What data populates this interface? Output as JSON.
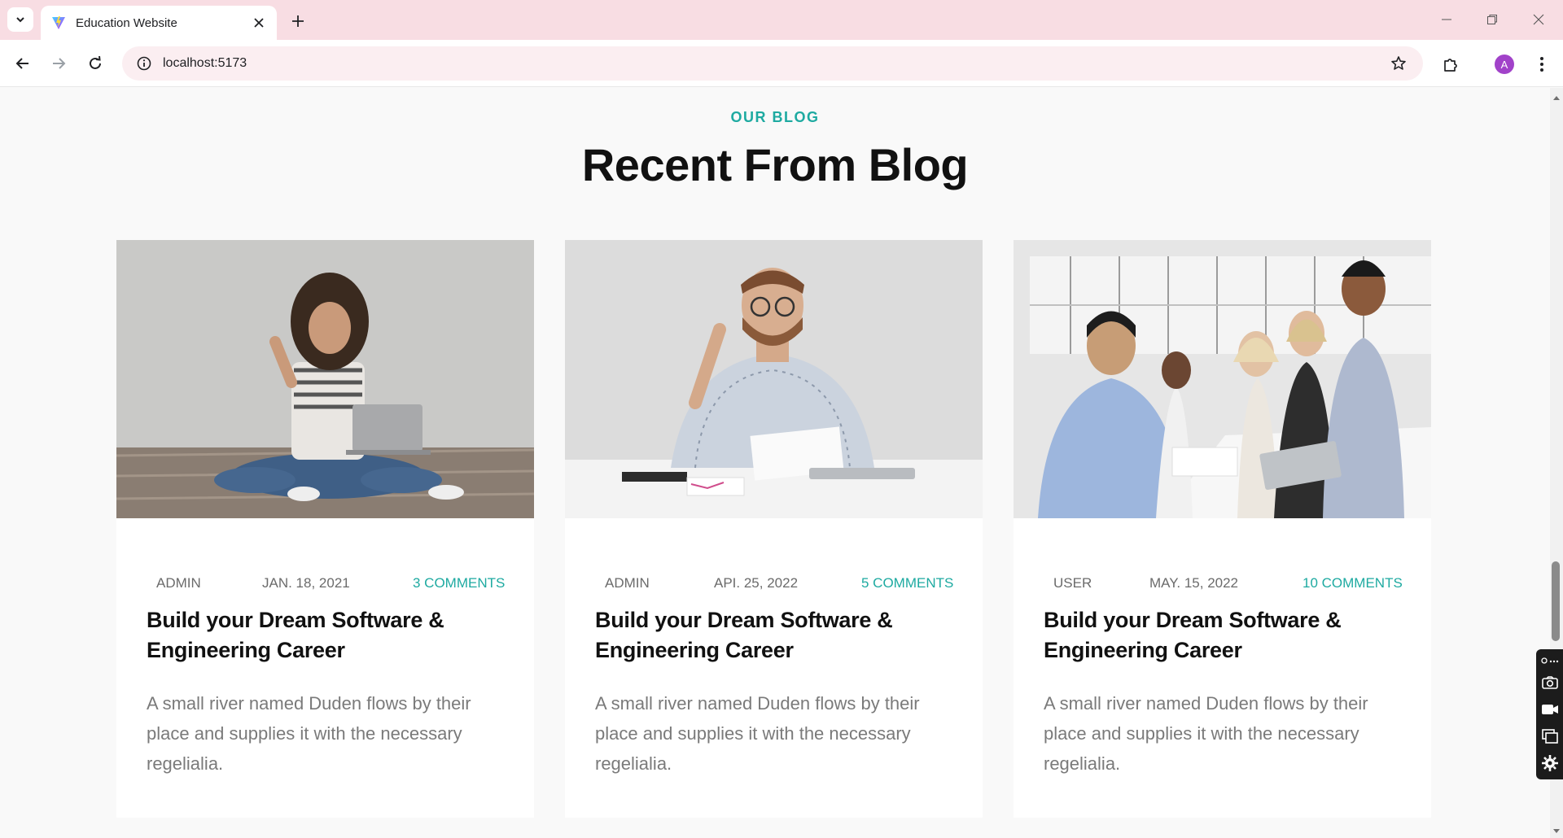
{
  "browser": {
    "tab_title": "Education Website",
    "url": "localhost:5173",
    "profile_initial": "A"
  },
  "section": {
    "eyebrow": "OUR BLOG",
    "heading": "Recent From Blog"
  },
  "posts": [
    {
      "image": "woman-with-laptop-photo",
      "author": "ADMIN",
      "date": "JAN. 18, 2021",
      "comments": "3 COMMENTS",
      "title": "Build your Dream Software & Engineering Career",
      "excerpt": "A small river named Duden flows by their place and supplies it with the necessary regelialia."
    },
    {
      "image": "man-at-desk-photo",
      "author": "ADMIN",
      "date": "API. 25, 2022",
      "comments": "5 COMMENTS",
      "title": "Build your Dream Software & Engineering Career",
      "excerpt": "A small river named Duden flows by their place and supplies it with the necessary regelialia."
    },
    {
      "image": "team-thumbs-up-photo",
      "author": "USER",
      "date": "MAY. 15, 2022",
      "comments": "10 COMMENTS",
      "title": "Build your Dream Software & Engineering Career",
      "excerpt": "A small river named Duden flows by their place and supplies it with the necessary regelialia."
    }
  ],
  "colors": {
    "accent": "#1eaaa1",
    "titlebar": "#f8dde3",
    "page_bg": "#f9f9f9"
  }
}
